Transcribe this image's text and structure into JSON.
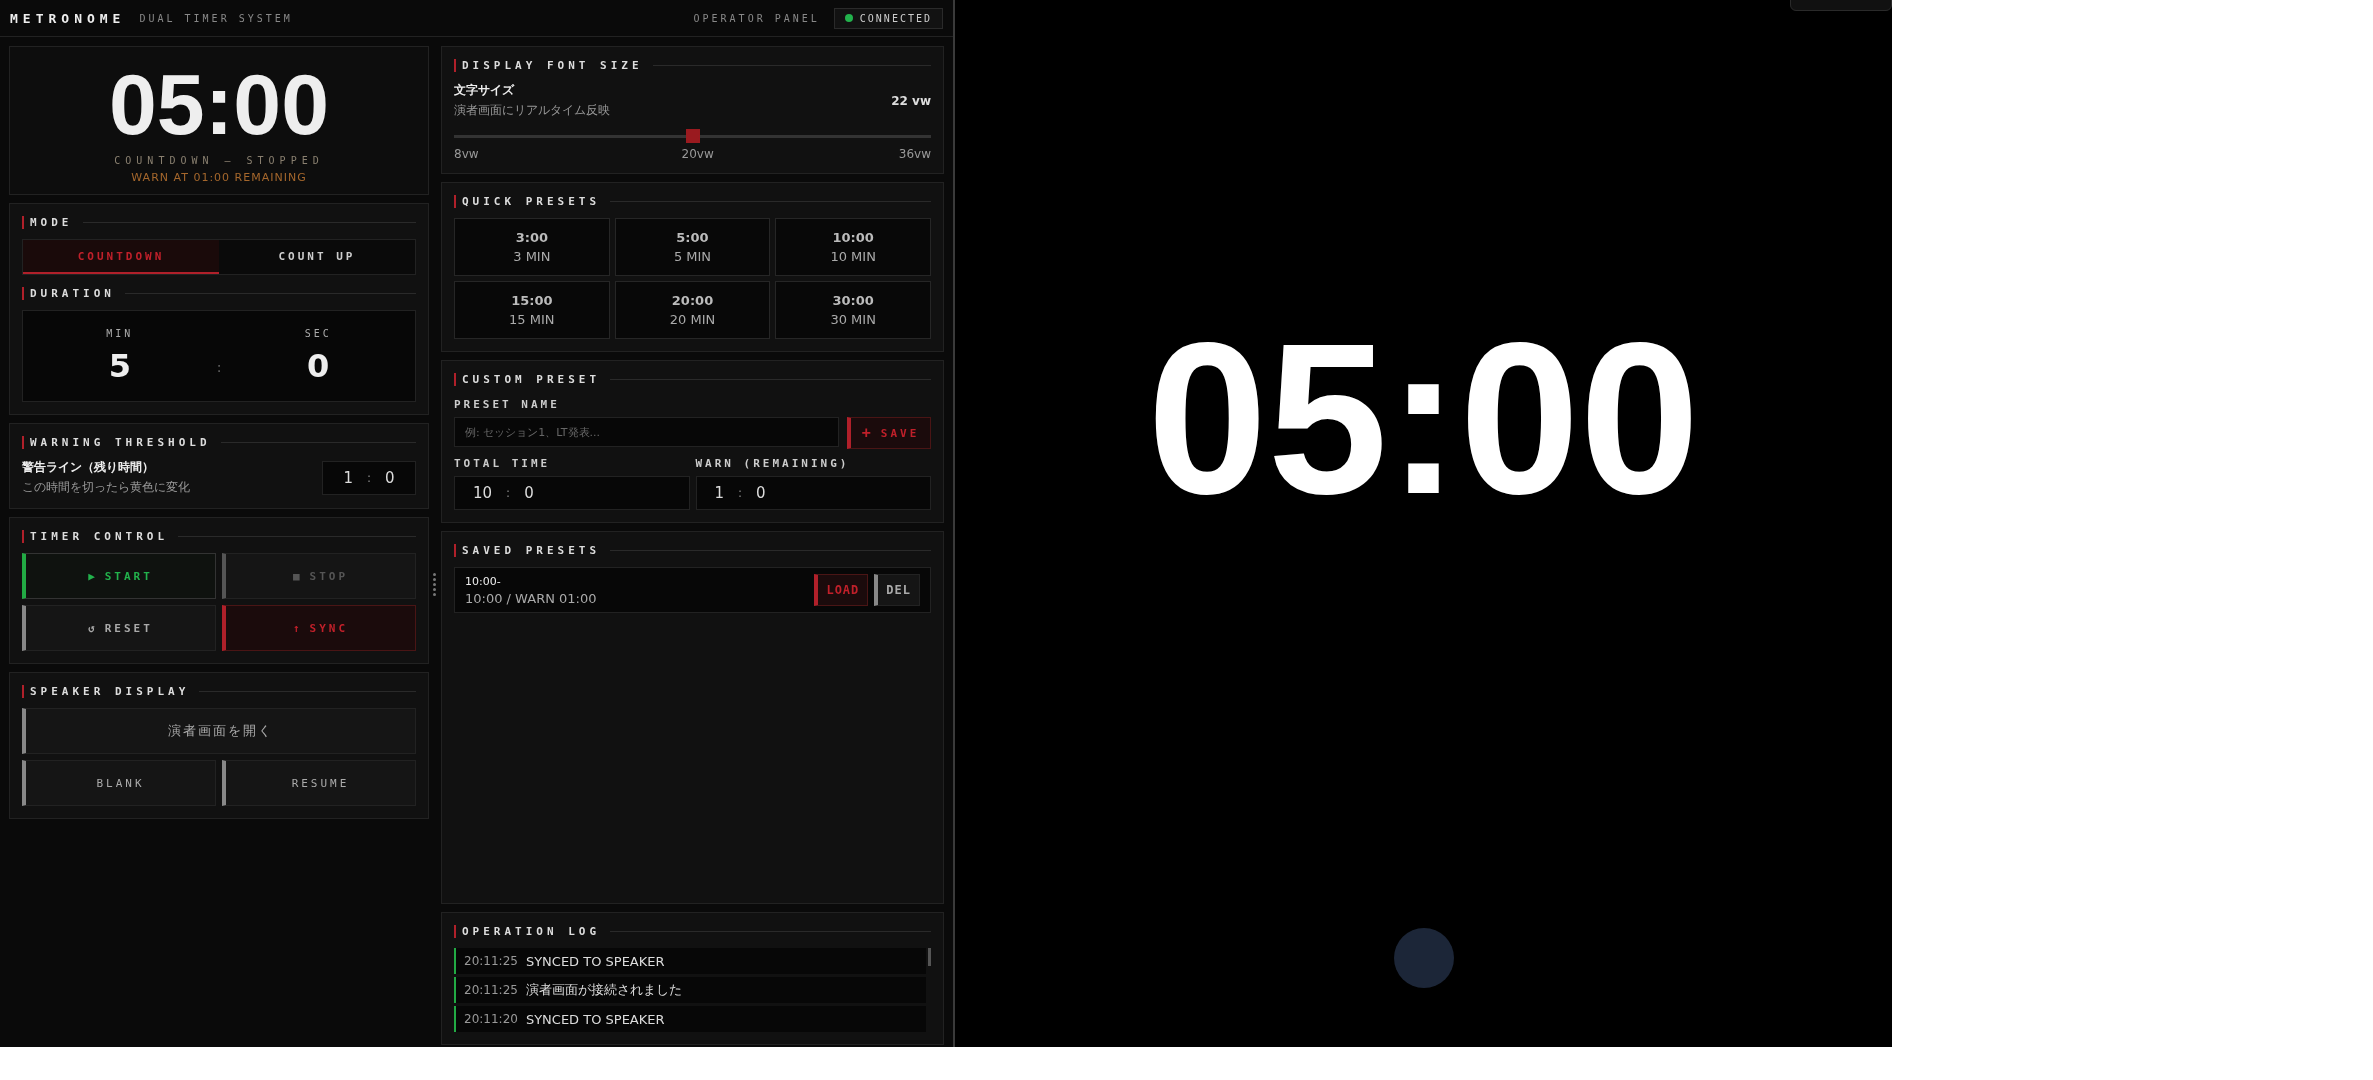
{
  "header": {
    "logo": "METRONOME",
    "subtitle": "DUAL TIMER SYSTEM",
    "panel_label": "OPERATOR PANEL",
    "status": {
      "label": "CONNECTED",
      "online": true
    }
  },
  "timer": {
    "display": "05:00",
    "state": "COUNTDOWN — STOPPED",
    "warning": "WARN AT 01:00 REMAINING"
  },
  "mode": {
    "title": "MODE",
    "tabs": [
      {
        "label": "COUNTDOWN",
        "selected": true
      },
      {
        "label": "COUNT UP",
        "selected": false
      }
    ]
  },
  "duration": {
    "title": "DURATION",
    "min": {
      "label": "MIN",
      "value": "5"
    },
    "separator": ":",
    "sec": {
      "label": "SEC",
      "value": "0"
    }
  },
  "warning": {
    "title": "WARNING THRESHOLD",
    "label": "警告ライン（残り時間）",
    "hint": "この時間を切ったら黄色に変化",
    "min": "1",
    "separator": ":",
    "sec": "0"
  },
  "timer_control": {
    "title": "TIMER CONTROL",
    "buttons": [
      {
        "kind": "start",
        "icon": "▶",
        "label": "START",
        "disabled": false
      },
      {
        "kind": "stop",
        "icon": "■",
        "label": "STOP",
        "disabled": true
      },
      {
        "kind": "reset",
        "icon": "↺",
        "label": "RESET",
        "disabled": false
      },
      {
        "kind": "sync",
        "icon": "↑",
        "label": "SYNC",
        "disabled": false
      }
    ]
  },
  "speaker_display": {
    "title": "SPEAKER DISPLAY",
    "buttons": [
      {
        "label": "演者画面を開く",
        "wide": true
      },
      {
        "label": "BLANK",
        "wide": false
      },
      {
        "label": "RESUME",
        "wide": false
      }
    ]
  },
  "font_size": {
    "title": "DISPLAY FONT SIZE",
    "label": "文字サイズ",
    "hint": "演者画面にリアルタイム反映",
    "value": "22 vw",
    "level": 0.5,
    "ticks": [
      "8vw",
      "20vw",
      "36vw"
    ]
  },
  "quick_presets": {
    "title": "QUICK PRESETS",
    "items": [
      {
        "time": "3:00",
        "label": "3 MIN"
      },
      {
        "time": "5:00",
        "label": "5 MIN"
      },
      {
        "time": "10:00",
        "label": "10 MIN"
      },
      {
        "time": "15:00",
        "label": "15 MIN"
      },
      {
        "time": "20:00",
        "label": "20 MIN"
      },
      {
        "time": "30:00",
        "label": "30 MIN"
      }
    ]
  },
  "custom_preset": {
    "title": "CUSTOM PRESET",
    "name_label": "PRESET NAME",
    "placeholder": "例: セッション1、LT発表...",
    "save": {
      "icon": "+",
      "label": "SAVE"
    },
    "total": {
      "label": "TOTAL TIME",
      "min": "10",
      "separator": ":",
      "sec": "0"
    },
    "warn": {
      "label": "WARN (REMAINING)",
      "min": "1",
      "separator": ":",
      "sec": "0"
    }
  },
  "saved_presets": {
    "title": "SAVED PRESETS",
    "items": [
      {
        "name": "10:00-",
        "detail": "10:00 / WARN 01:00",
        "load": "LOAD",
        "delete": "DEL"
      }
    ]
  },
  "log": {
    "title": "OPERATION LOG",
    "entries": [
      {
        "time": "20:11:25",
        "message": "SYNCED TO SPEAKER"
      },
      {
        "time": "20:11:25",
        "message": "演者画面が接続されました"
      },
      {
        "time": "20:11:20",
        "message": "SYNCED TO SPEAKER"
      }
    ]
  },
  "speaker": {
    "display": "05:00"
  }
}
